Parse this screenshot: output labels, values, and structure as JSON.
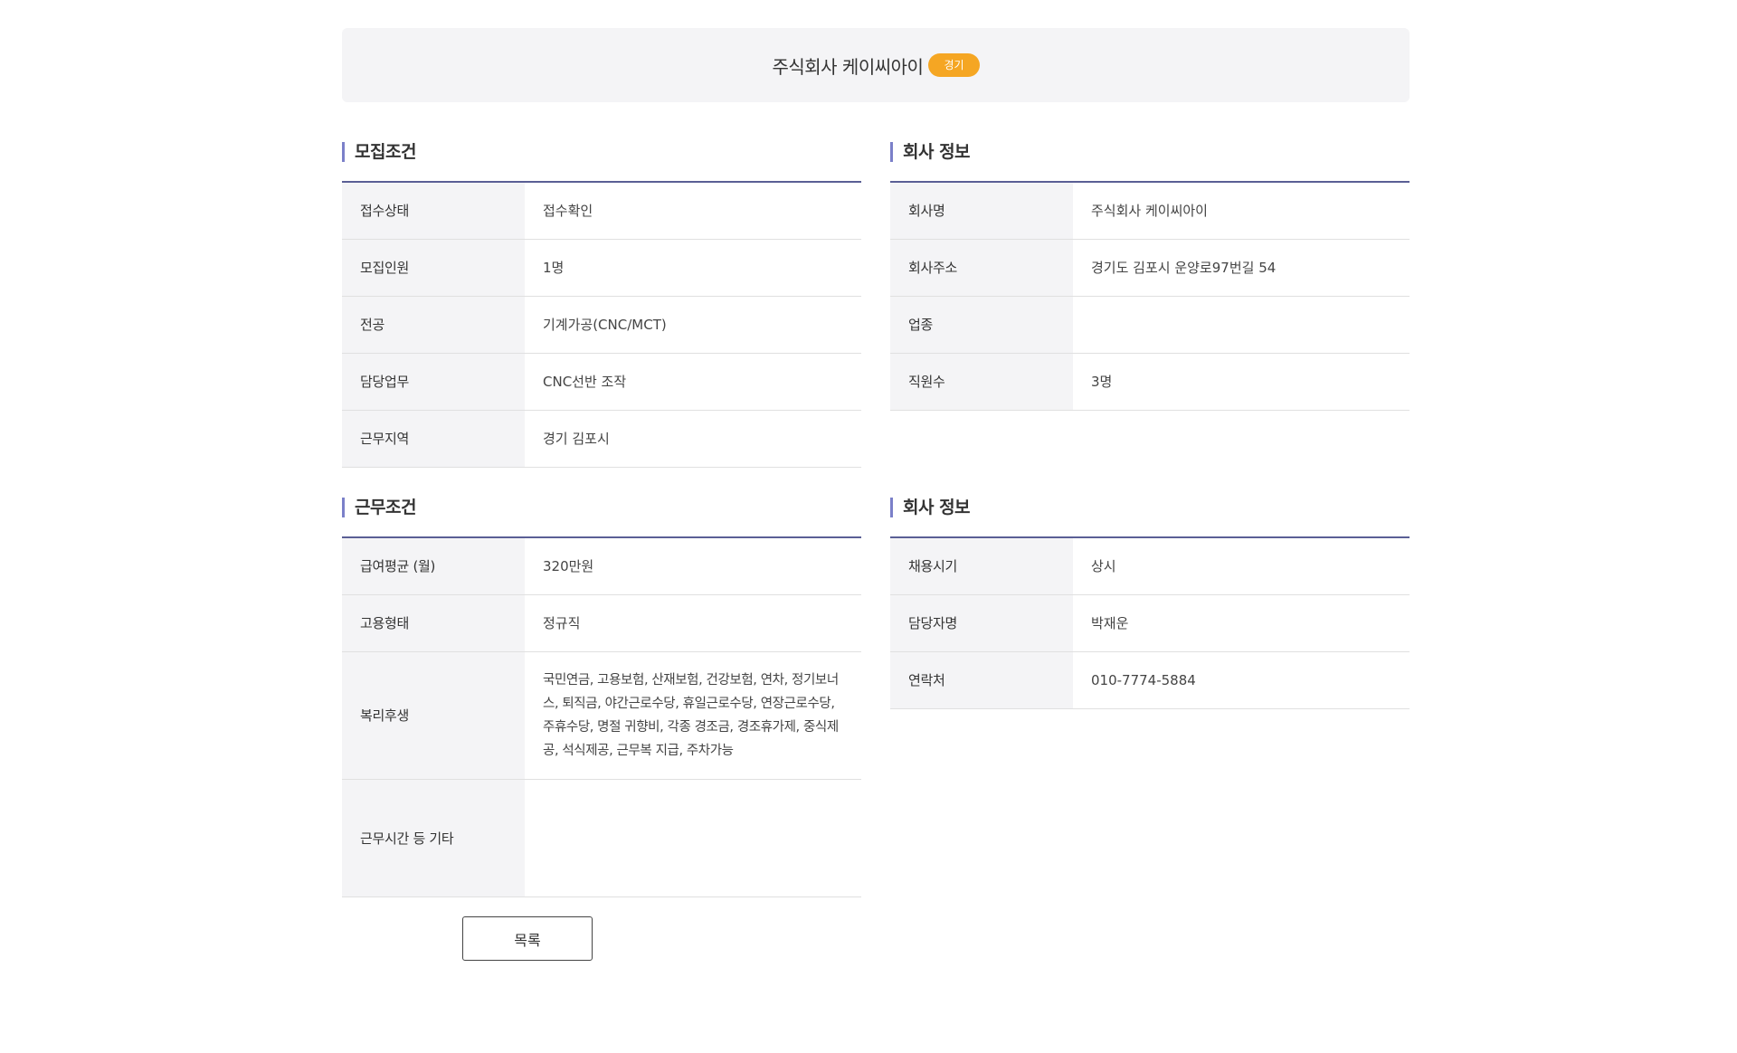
{
  "header": {
    "company_name": "주식회사 케이씨아이",
    "region_badge": "경기"
  },
  "recruit": {
    "title": "모집조건",
    "rows": [
      {
        "label": "접수상태",
        "value": "접수확인"
      },
      {
        "label": "모집인원",
        "value": "1명"
      },
      {
        "label": "전공",
        "value": "기계가공(CNC/MCT)"
      },
      {
        "label": "담당업무",
        "value": "CNC선반 조작"
      },
      {
        "label": "근무지역",
        "value": "경기 김포시"
      }
    ]
  },
  "company": {
    "title": "회사 정보",
    "rows": [
      {
        "label": "회사명",
        "value": "주식회사 케이씨아이"
      },
      {
        "label": "회사주소",
        "value": "경기도 김포시 운양로97번길 54"
      },
      {
        "label": "업종",
        "value": ""
      },
      {
        "label": "직원수",
        "value": "3명"
      }
    ]
  },
  "work": {
    "title": "근무조건",
    "rows": [
      {
        "label": "급여평균 (월)",
        "value": "320만원"
      },
      {
        "label": "고용형태",
        "value": "정규직"
      },
      {
        "label": "복리후생",
        "value": "국민연금, 고용보험, 산재보험, 건강보험, 연차, 정기보너스, 퇴직금, 야간근로수당, 휴일근로수당, 연장근로수당, 주휴수당, 명절 귀향비, 각종 경조금, 경조휴가제, 중식제공, 석식제공, 근무복 지급, 주차가능"
      },
      {
        "label": "근무시간 등 기타",
        "value": ""
      }
    ]
  },
  "contact": {
    "title": "회사 정보",
    "rows": [
      {
        "label": "채용시기",
        "value": "상시"
      },
      {
        "label": "담당자명",
        "value": "박재운"
      },
      {
        "label": "연락처",
        "value": "010-7774-5884"
      }
    ]
  },
  "buttons": {
    "list_label": "목록"
  },
  "colors": {
    "accent": "#7b80c9",
    "table_border": "#5a5f95",
    "badge": "#f5a623",
    "label_bg": "#f4f4f6"
  }
}
